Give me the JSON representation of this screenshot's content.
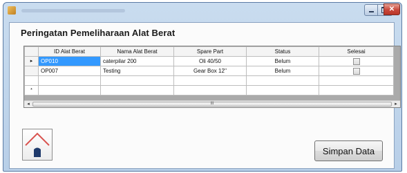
{
  "window": {
    "min_icon": "minimize-icon",
    "max_icon": "maximize-icon",
    "close_icon": "close-icon",
    "close_color": "#c8473a"
  },
  "page": {
    "title": "Peringatan Pemeliharaan Alat Berat"
  },
  "grid": {
    "columns": [
      "ID Alat Berat",
      "Nama Alat Berat",
      "Spare Part",
      "Status",
      "Selesai"
    ],
    "rows": [
      {
        "indicator": "▸",
        "id": "OP010",
        "nama": "caterpilar 200",
        "spare": "Oli 40/50",
        "status": "Belum",
        "selesai": false,
        "selected": true
      },
      {
        "indicator": "",
        "id": "OP007",
        "nama": "Testing",
        "spare": "Gear Box 12''",
        "status": "Belum",
        "selesai": false,
        "selected": false
      }
    ],
    "new_row_indicator": "*",
    "scroll_left": "◂",
    "scroll_right": "▸",
    "scroll_thumb": "III",
    "selection_color": "#3399ff"
  },
  "home_button": {
    "icon": "house-icon",
    "roof_color": "#d9534f",
    "door_color": "#1f3a6b"
  },
  "save_button": {
    "label": "Simpan Data"
  }
}
